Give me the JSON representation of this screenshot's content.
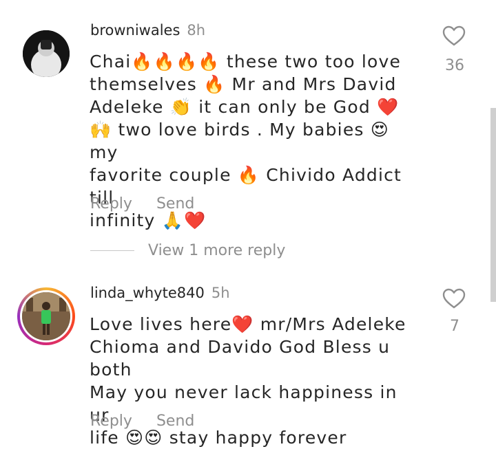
{
  "comments": [
    {
      "username": "browniwales",
      "time": "8h",
      "text": "Chai🔥🔥🔥🔥 these two too love\nthemselves 🔥 Mr and Mrs David\nAdeleke 👏 it can only be God ❤️\n🙌 two love birds . My babies 😍 my\nfavorite couple 🔥 Chivido Addict till\ninfinity 🙏❤️",
      "like_count": "36",
      "reply_label": "Reply",
      "send_label": "Send"
    },
    {
      "username": "linda_whyte840",
      "time": "5h",
      "text": "Love lives here❤️ mr/Mrs Adeleke\nChioma and Davido God Bless u both\nMay you never lack happiness in ur\nlife 😍😍 stay happy forever",
      "like_count": "7",
      "reply_label": "Reply",
      "send_label": "Send"
    }
  ],
  "view_more_label": "View 1 more reply",
  "icons": {
    "like": "heart-outline-icon"
  }
}
